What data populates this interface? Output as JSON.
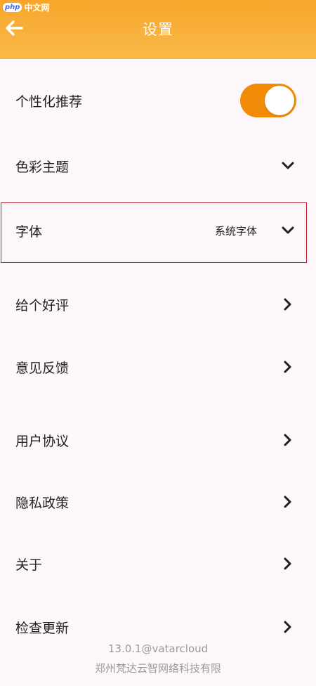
{
  "watermark": {
    "badge": "php",
    "text": "中文网"
  },
  "header": {
    "title": "设置",
    "back_icon": "arrow-left-icon",
    "bg_color": "#f7a62a"
  },
  "settings": {
    "personalized": {
      "label": "个性化推荐",
      "enabled": true,
      "toggle_color": "#f18a05"
    },
    "color_theme": {
      "label": "色彩主题",
      "icon": "chevron-down-icon"
    },
    "font": {
      "label": "字体",
      "value": "系统字体",
      "icon": "chevron-down-icon",
      "highlight_color": "#b3252e"
    },
    "rate": {
      "label": "给个好评",
      "icon": "chevron-right-icon"
    },
    "feedback": {
      "label": "意见反馈",
      "icon": "chevron-right-icon"
    },
    "agreement": {
      "label": "用户协议",
      "icon": "chevron-right-icon"
    },
    "privacy": {
      "label": "隐私政策",
      "icon": "chevron-right-icon"
    },
    "about": {
      "label": "关于",
      "icon": "chevron-right-icon"
    },
    "update": {
      "label": "检查更新",
      "icon": "chevron-right-icon"
    }
  },
  "footer": {
    "version": "13.0.1@vatarcloud",
    "company": "郑州梵达云智网络科技有限"
  }
}
